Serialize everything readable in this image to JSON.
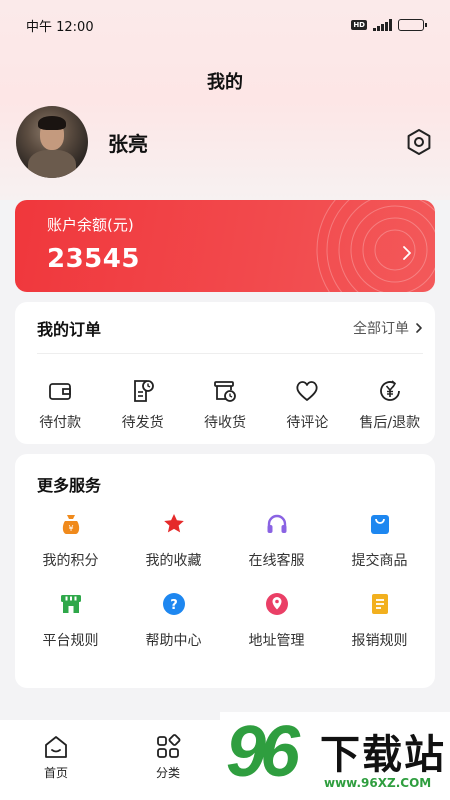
{
  "status_bar": {
    "time": "中午 12:00"
  },
  "header": {
    "title": "我的"
  },
  "profile": {
    "name": "张亮"
  },
  "balance": {
    "label": "账户余额(元)",
    "value": "23545"
  },
  "orders": {
    "title": "我的订单",
    "all_label": "全部订单",
    "items": [
      {
        "label": "待付款",
        "icon": "wallet-icon"
      },
      {
        "label": "待发货",
        "icon": "invoice-clock-icon"
      },
      {
        "label": "待收货",
        "icon": "box-clock-icon"
      },
      {
        "label": "待评论",
        "icon": "heart-icon"
      },
      {
        "label": "售后/退款",
        "icon": "refund-yen-icon"
      }
    ]
  },
  "services": {
    "title": "更多服务",
    "items": [
      {
        "label": "我的积分",
        "icon": "points-bag-icon",
        "color": "#f08a1c"
      },
      {
        "label": "我的收藏",
        "icon": "star-icon",
        "color": "#e52a2a"
      },
      {
        "label": "在线客服",
        "icon": "headset-icon",
        "color": "#8a63e3"
      },
      {
        "label": "提交商品",
        "icon": "shopping-bag-icon",
        "color": "#1e87f0"
      },
      {
        "label": "平台规则",
        "icon": "store-icon",
        "color": "#2fa84a"
      },
      {
        "label": "帮助中心",
        "icon": "help-circle-icon",
        "color": "#1e87f0"
      },
      {
        "label": "地址管理",
        "icon": "location-pin-icon",
        "color": "#ea3f66"
      },
      {
        "label": "报销规则",
        "icon": "document-icon",
        "color": "#f2b01e"
      }
    ]
  },
  "tabs": [
    {
      "label": "首页",
      "icon": "home-icon"
    },
    {
      "label": "分类",
      "icon": "category-icon"
    }
  ],
  "watermark": {
    "number": "96",
    "text": "下载站",
    "url": "www.96XZ.COM"
  },
  "colors": {
    "accent": "#f0373c",
    "page_bg": "#f3f3f5"
  }
}
